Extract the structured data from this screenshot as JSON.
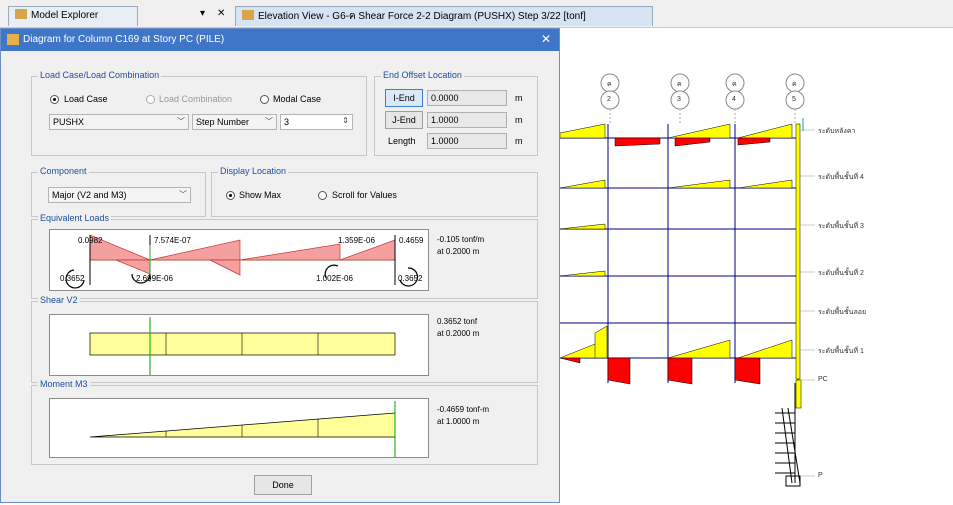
{
  "tabs": {
    "model_explorer": "Model Explorer",
    "pin_glyph": "▾",
    "close_glyph": "✕",
    "elevation": "Elevation View - G6-ฅ   Shear Force 2-2 Diagram   (PUSHX)  Step 3/22  [tonf]"
  },
  "dialog": {
    "title": "Diagram for Column C169 at Story PC (PILE)",
    "close_glyph": "✕",
    "load": {
      "group": "Load Case/Load Combination",
      "load_case": "Load Case",
      "load_combination": "Load Combination",
      "modal_case": "Modal Case",
      "case_value": "PUSHX",
      "step_mode": "Step Number",
      "step_value": "3",
      "selected": "Load Case"
    },
    "offset": {
      "group": "End Offset Location",
      "i_end_btn": "I-End",
      "i_end_val": "0.0000",
      "j_end_btn": "J-End",
      "j_end_val": "1.0000",
      "length_lbl": "Length",
      "length_val": "1.0000",
      "unit": "m"
    },
    "component": {
      "group": "Component",
      "value": "Major (V2 and M3)"
    },
    "display": {
      "group": "Display Location",
      "show_max": "Show Max",
      "scroll": "Scroll for Values",
      "selected": "Show Max"
    },
    "equiv": {
      "group": "Equivalent Loads",
      "labels": {
        "tl": "0.0982",
        "bl": "0.3652",
        "t1": "7.574E-07",
        "b1": "2.699E-06",
        "t2": "1.359E-06",
        "b2": "1.002E-06",
        "tr": "0.4659",
        "br": "0.3652"
      },
      "readout1": "-0.105 tonf/m",
      "readout2": "at 0.2000 m"
    },
    "shear": {
      "group": "Shear V2",
      "readout1": "0.3652 tonf",
      "readout2": "at 0.2000 m",
      "value": 0.3652,
      "at": 0.2
    },
    "moment": {
      "group": "Moment M3",
      "readout1": "-0.4659 tonf-m",
      "readout2": "at 1.0000 m",
      "values": [
        0,
        -0.4659
      ]
    },
    "done": "Done"
  },
  "elevation": {
    "grid_bubbles": [
      "2",
      "3",
      "4",
      "5"
    ],
    "bubble_top": [
      "ค",
      "ค",
      "ค",
      "ค"
    ],
    "story_labels": [
      "ระดับหลังคา",
      "ระดับพื้นชั้นที่ 4",
      "ระดับพื้นชั้นที่ 3",
      "ระดับพื้นชั้นที่ 2",
      "ระดับพื้นชั้นลอย",
      "ระดับพื้นชั้นที่ 1",
      "PC",
      "P"
    ],
    "colors": {
      "positive": "#ffff00",
      "negative": "#ff0000",
      "frame": "#000080"
    }
  },
  "colors": {
    "accent": "#3f76c8",
    "diagram_fill": "#ffff99",
    "load_fill": "#f4a0a0",
    "cursor_line": "#00a000"
  }
}
